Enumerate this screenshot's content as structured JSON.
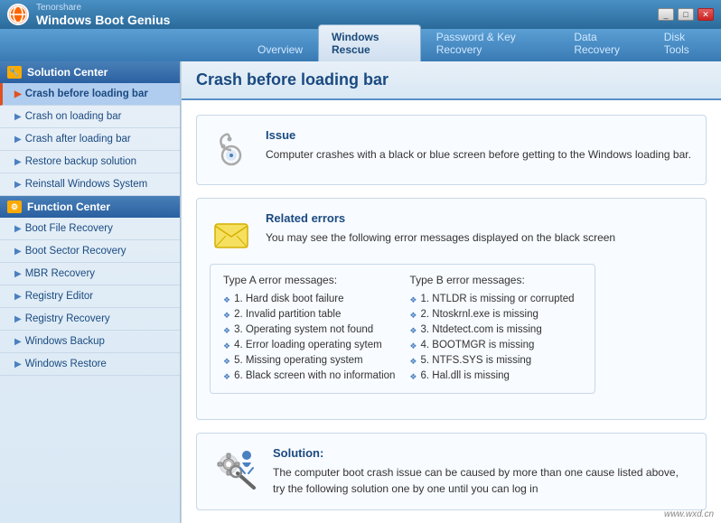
{
  "titlebar": {
    "company": "Tenorshare",
    "title": "Windows Boot Genius",
    "controls": {
      "minimize": "_",
      "restore": "□",
      "close": "✕"
    }
  },
  "nav": {
    "tabs": [
      {
        "label": "Overview",
        "active": false
      },
      {
        "label": "Windows Rescue",
        "active": true
      },
      {
        "label": "Password & Key Recovery",
        "active": false
      },
      {
        "label": "Data Recovery",
        "active": false
      },
      {
        "label": "Disk Tools",
        "active": false
      }
    ]
  },
  "sidebar": {
    "solution_center": {
      "header": "Solution Center",
      "items": [
        {
          "label": "Crash before loading bar",
          "active": true
        },
        {
          "label": "Crash on loading bar",
          "active": false
        },
        {
          "label": "Crash after loading bar",
          "active": false
        },
        {
          "label": "Restore backup solution",
          "active": false
        },
        {
          "label": "Reinstall Windows System",
          "active": false
        }
      ]
    },
    "function_center": {
      "header": "Function Center",
      "items": [
        {
          "label": "Boot File Recovery",
          "active": false
        },
        {
          "label": "Boot Sector Recovery",
          "active": false
        },
        {
          "label": "MBR Recovery",
          "active": false
        },
        {
          "label": "Registry Editor",
          "active": false
        },
        {
          "label": "Registry Recovery",
          "active": false
        },
        {
          "label": "Windows Backup",
          "active": false
        },
        {
          "label": "Windows Restore",
          "active": false
        }
      ]
    }
  },
  "content": {
    "title": "Crash before loading bar",
    "issue": {
      "title": "Issue",
      "text": "Computer crashes with a black or blue screen before getting to the Windows loading bar."
    },
    "related_errors": {
      "title": "Related errors",
      "subtitle": "You may see the following error messages displayed on the black screen",
      "typeA": {
        "title": "Type A error messages:",
        "errors": [
          "1. Hard disk boot failure",
          "2. Invalid partition table",
          "3. Operating system not found",
          "4. Error loading operating sytem",
          "5. Missing operating system",
          "6. Black screen with no information"
        ]
      },
      "typeB": {
        "title": "Type B error messages:",
        "errors": [
          "1. NTLDR is missing or corrupted",
          "2. Ntoskrnl.exe is missing",
          "3. Ntdetect.com is missing",
          "4. BOOTMGR is missing",
          "5. NTFS.SYS is missing",
          "6. Hal.dll is missing"
        ]
      }
    },
    "solution": {
      "title": "Solution:",
      "text": "The computer boot crash issue can be caused by more than one cause listed above, try the following solution one by one until you can log in"
    }
  },
  "watermark": "www.wxd.cn"
}
